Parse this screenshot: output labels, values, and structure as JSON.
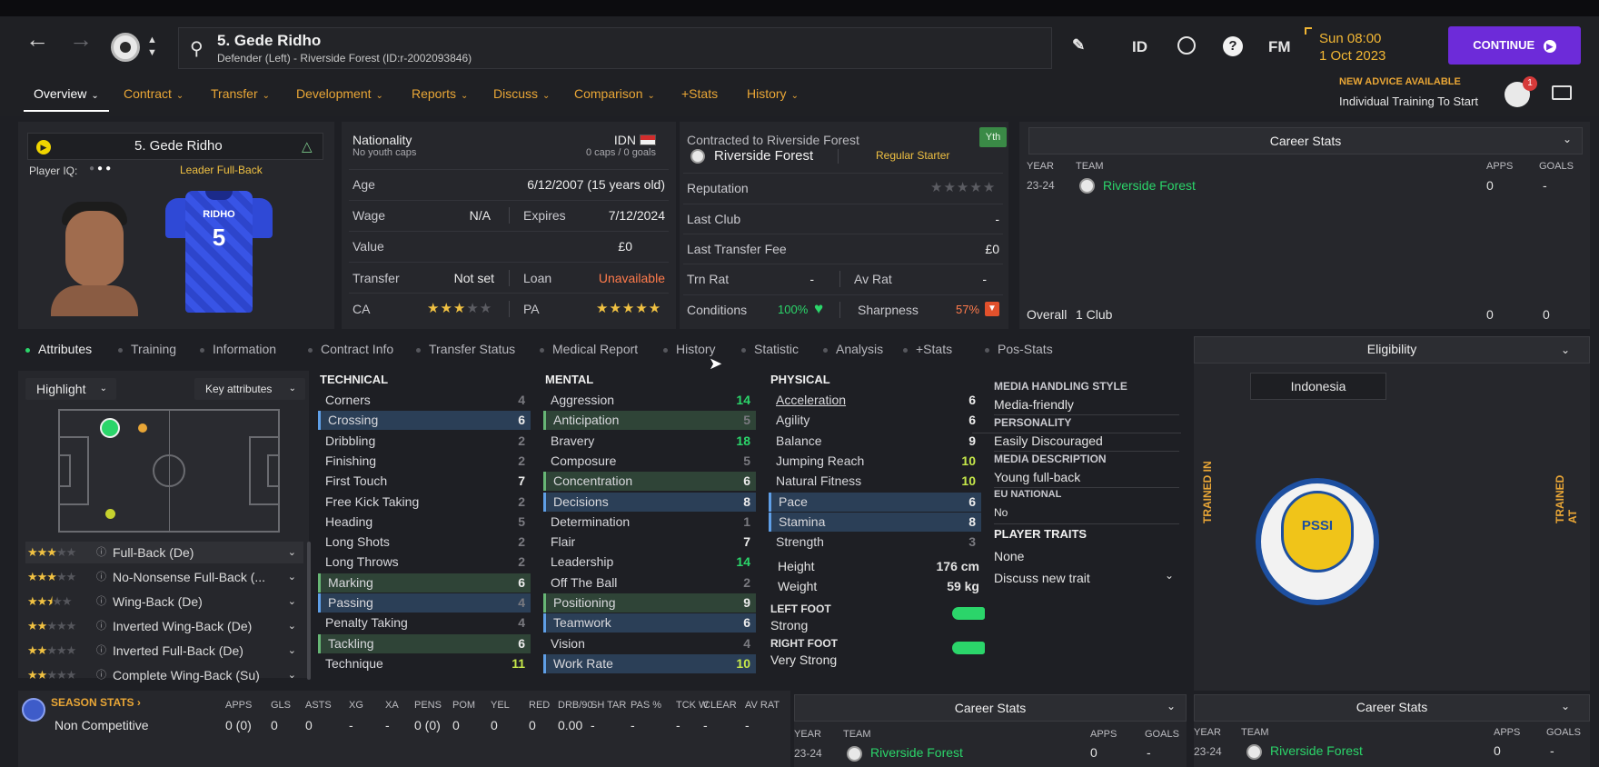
{
  "header": {
    "search_title": "5. Gede Ridho",
    "search_subtitle": "Defender (Left) - Riverside Forest (ID:r-2002093846)",
    "icons": [
      "back-icon",
      "forward-icon",
      "club-badge-icon",
      "search-icon",
      "pencil-icon",
      "world-icon",
      "help-icon"
    ],
    "id_label": "ID",
    "fm_label": "FM",
    "date_time": "Sun 08:00",
    "date": "1 Oct 2023",
    "continue_label": "CONTINUE",
    "advice_title": "NEW ADVICE AVAILABLE",
    "advice_text": "Individual Training To Start",
    "notification_count": "1"
  },
  "menu": {
    "items": [
      "Overview",
      "Contract",
      "Transfer",
      "Development",
      "Reports",
      "Discuss",
      "Comparison",
      "+Stats",
      "History"
    ],
    "active": "Overview"
  },
  "player_card": {
    "name": "5. Gede Ridho",
    "iq_label": "Player IQ:",
    "role_label": "Leader Full-Back",
    "shirt_name": "RIDHO",
    "shirt_number": "5"
  },
  "info": {
    "nationality_label": "Nationality",
    "youth_caps": "No youth caps",
    "nation_code": "IDN",
    "caps_goals": "0 caps / 0 goals",
    "age_label": "Age",
    "age_value": "6/12/2007 (15 years old)",
    "wage_label": "Wage",
    "wage_value": "N/A",
    "expires_label": "Expires",
    "expires_value": "7/12/2024",
    "value_label": "Value",
    "value_value": "£0",
    "transfer_label": "Transfer",
    "transfer_value": "Not set",
    "loan_label": "Loan",
    "loan_value": "Unavailable",
    "ca_label": "CA",
    "ca_stars": 3,
    "pa_label": "PA",
    "pa_stars": 5
  },
  "contract": {
    "contracted_to": "Contracted to Riverside Forest",
    "youth_badge": "Yth",
    "club": "Riverside Forest",
    "squad_status": "Regular Starter",
    "reputation_label": "Reputation",
    "reputation_stars": 0,
    "last_club_label": "Last Club",
    "last_club_value": "-",
    "last_fee_label": "Last Transfer Fee",
    "last_fee_value": "£0",
    "trn_label": "Trn Rat",
    "trn_value": "-",
    "av_label": "Av Rat",
    "av_value": "-",
    "conditions_label": "Conditions",
    "conditions_value": "100%",
    "sharpness_label": "Sharpness",
    "sharpness_value": "57%"
  },
  "career_top": {
    "title": "Career Stats",
    "col_year": "YEAR",
    "col_team": "TEAM",
    "col_apps": "APPS",
    "col_goals": "GOALS",
    "year": "23-24",
    "team": "Riverside Forest",
    "apps": "0",
    "goals": "-",
    "overall_label": "Overall",
    "overall_clubs": "1 Club",
    "overall_apps": "0",
    "overall_goals": "0"
  },
  "tabs": {
    "items": [
      "Attributes",
      "Training",
      "Information",
      "Contract Info",
      "Transfer Status",
      "Medical Report",
      "History",
      "Statistic",
      "Analysis",
      "+Stats",
      "Pos-Stats"
    ],
    "active": "Attributes"
  },
  "eligibility": {
    "title": "Eligibility",
    "nation": "Indonesia",
    "trained_in": "TRAINED IN",
    "trained_at": "TRAINED AT",
    "logo_text": "PSSI"
  },
  "controls": {
    "highlight": "Highlight",
    "key_attributes": "Key attributes"
  },
  "technical": {
    "title": "TECHNICAL",
    "rows": [
      {
        "n": "Corners",
        "v": "4",
        "h": ""
      },
      {
        "n": "Crossing",
        "v": "6",
        "h": "blue"
      },
      {
        "n": "Dribbling",
        "v": "2",
        "h": ""
      },
      {
        "n": "Finishing",
        "v": "2",
        "h": ""
      },
      {
        "n": "First Touch",
        "v": "7",
        "h": ""
      },
      {
        "n": "Free Kick Taking",
        "v": "2",
        "h": ""
      },
      {
        "n": "Heading",
        "v": "5",
        "h": ""
      },
      {
        "n": "Long Shots",
        "v": "2",
        "h": ""
      },
      {
        "n": "Long Throws",
        "v": "2",
        "h": ""
      },
      {
        "n": "Marking",
        "v": "6",
        "h": "green"
      },
      {
        "n": "Passing",
        "v": "4",
        "h": "blue"
      },
      {
        "n": "Penalty Taking",
        "v": "4",
        "h": ""
      },
      {
        "n": "Tackling",
        "v": "6",
        "h": "green"
      },
      {
        "n": "Technique",
        "v": "11",
        "h": ""
      }
    ]
  },
  "mental": {
    "title": "MENTAL",
    "rows": [
      {
        "n": "Aggression",
        "v": "14",
        "h": ""
      },
      {
        "n": "Anticipation",
        "v": "5",
        "h": "green"
      },
      {
        "n": "Bravery",
        "v": "18",
        "h": ""
      },
      {
        "n": "Composure",
        "v": "5",
        "h": ""
      },
      {
        "n": "Concentration",
        "v": "6",
        "h": "green"
      },
      {
        "n": "Decisions",
        "v": "8",
        "h": "blue"
      },
      {
        "n": "Determination",
        "v": "1",
        "h": ""
      },
      {
        "n": "Flair",
        "v": "7",
        "h": ""
      },
      {
        "n": "Leadership",
        "v": "14",
        "h": ""
      },
      {
        "n": "Off The Ball",
        "v": "2",
        "h": ""
      },
      {
        "n": "Positioning",
        "v": "9",
        "h": "green"
      },
      {
        "n": "Teamwork",
        "v": "6",
        "h": "blue"
      },
      {
        "n": "Vision",
        "v": "4",
        "h": ""
      },
      {
        "n": "Work Rate",
        "v": "10",
        "h": "blue"
      }
    ]
  },
  "physical": {
    "title": "PHYSICAL",
    "rows": [
      {
        "n": "Acceleration",
        "v": "6",
        "h": ""
      },
      {
        "n": "Agility",
        "v": "6",
        "h": ""
      },
      {
        "n": "Balance",
        "v": "9",
        "h": ""
      },
      {
        "n": "Jumping Reach",
        "v": "10",
        "h": ""
      },
      {
        "n": "Natural Fitness",
        "v": "10",
        "h": ""
      },
      {
        "n": "Pace",
        "v": "6",
        "h": "blue"
      },
      {
        "n": "Stamina",
        "v": "8",
        "h": "blue"
      },
      {
        "n": "Strength",
        "v": "3",
        "h": ""
      }
    ],
    "height_label": "Height",
    "height_value": "176 cm",
    "weight_label": "Weight",
    "weight_value": "59 kg",
    "left_foot_label": "LEFT FOOT",
    "left_foot_value": "Strong",
    "right_foot_label": "RIGHT FOOT",
    "right_foot_value": "Very Strong"
  },
  "profile": {
    "media_style_label": "MEDIA HANDLING STYLE",
    "media_style_value": "Media-friendly",
    "personality_label": "PERSONALITY",
    "personality_value": "Easily Discouraged",
    "media_desc_label": "MEDIA DESCRIPTION",
    "media_desc_value": "Young full-back",
    "eu_label": "EU NATIONAL",
    "eu_value": "No",
    "traits_label": "PLAYER TRAITS",
    "traits_value": "None",
    "discuss_trait": "Discuss new trait"
  },
  "roles": [
    {
      "name": "Full-Back (De)",
      "stars": 3
    },
    {
      "name": "No-Nonsense Full-Back (...",
      "stars": 3
    },
    {
      "name": "Wing-Back (De)",
      "stars": 2.5
    },
    {
      "name": "Inverted Wing-Back (De)",
      "stars": 2
    },
    {
      "name": "Inverted Full-Back (De)",
      "stars": 2
    },
    {
      "name": "Complete Wing-Back (Su)",
      "stars": 2
    }
  ],
  "season_stats": {
    "title": "SEASON STATS",
    "headers": [
      "APPS",
      "GLS",
      "ASTS",
      "XG",
      "XA",
      "PENS",
      "POM",
      "YEL",
      "RED",
      "DRB/90",
      "SH TAR",
      "PAS %",
      "TCK W",
      "CLEAR",
      "AV RAT"
    ],
    "row_label": "Non Competitive",
    "values": [
      "0 (0)",
      "0",
      "0",
      "-",
      "-",
      "0 (0)",
      "0",
      "0",
      "0",
      "0.00",
      "-",
      "-",
      "-",
      "-",
      "-"
    ]
  },
  "career_bottom": {
    "title": "Career Stats",
    "col_year": "YEAR",
    "col_team": "TEAM",
    "col_apps": "APPS",
    "col_goals": "GOALS",
    "year": "23-24",
    "team": "Riverside Forest",
    "apps": "0",
    "goals": "-"
  },
  "colors": {
    "accent_orange": "#e9a636",
    "continue_purple": "#6d2bd9",
    "positive_green": "#2bd56a",
    "highlight_blue": "#2b3f57",
    "highlight_green": "#2f4437"
  }
}
